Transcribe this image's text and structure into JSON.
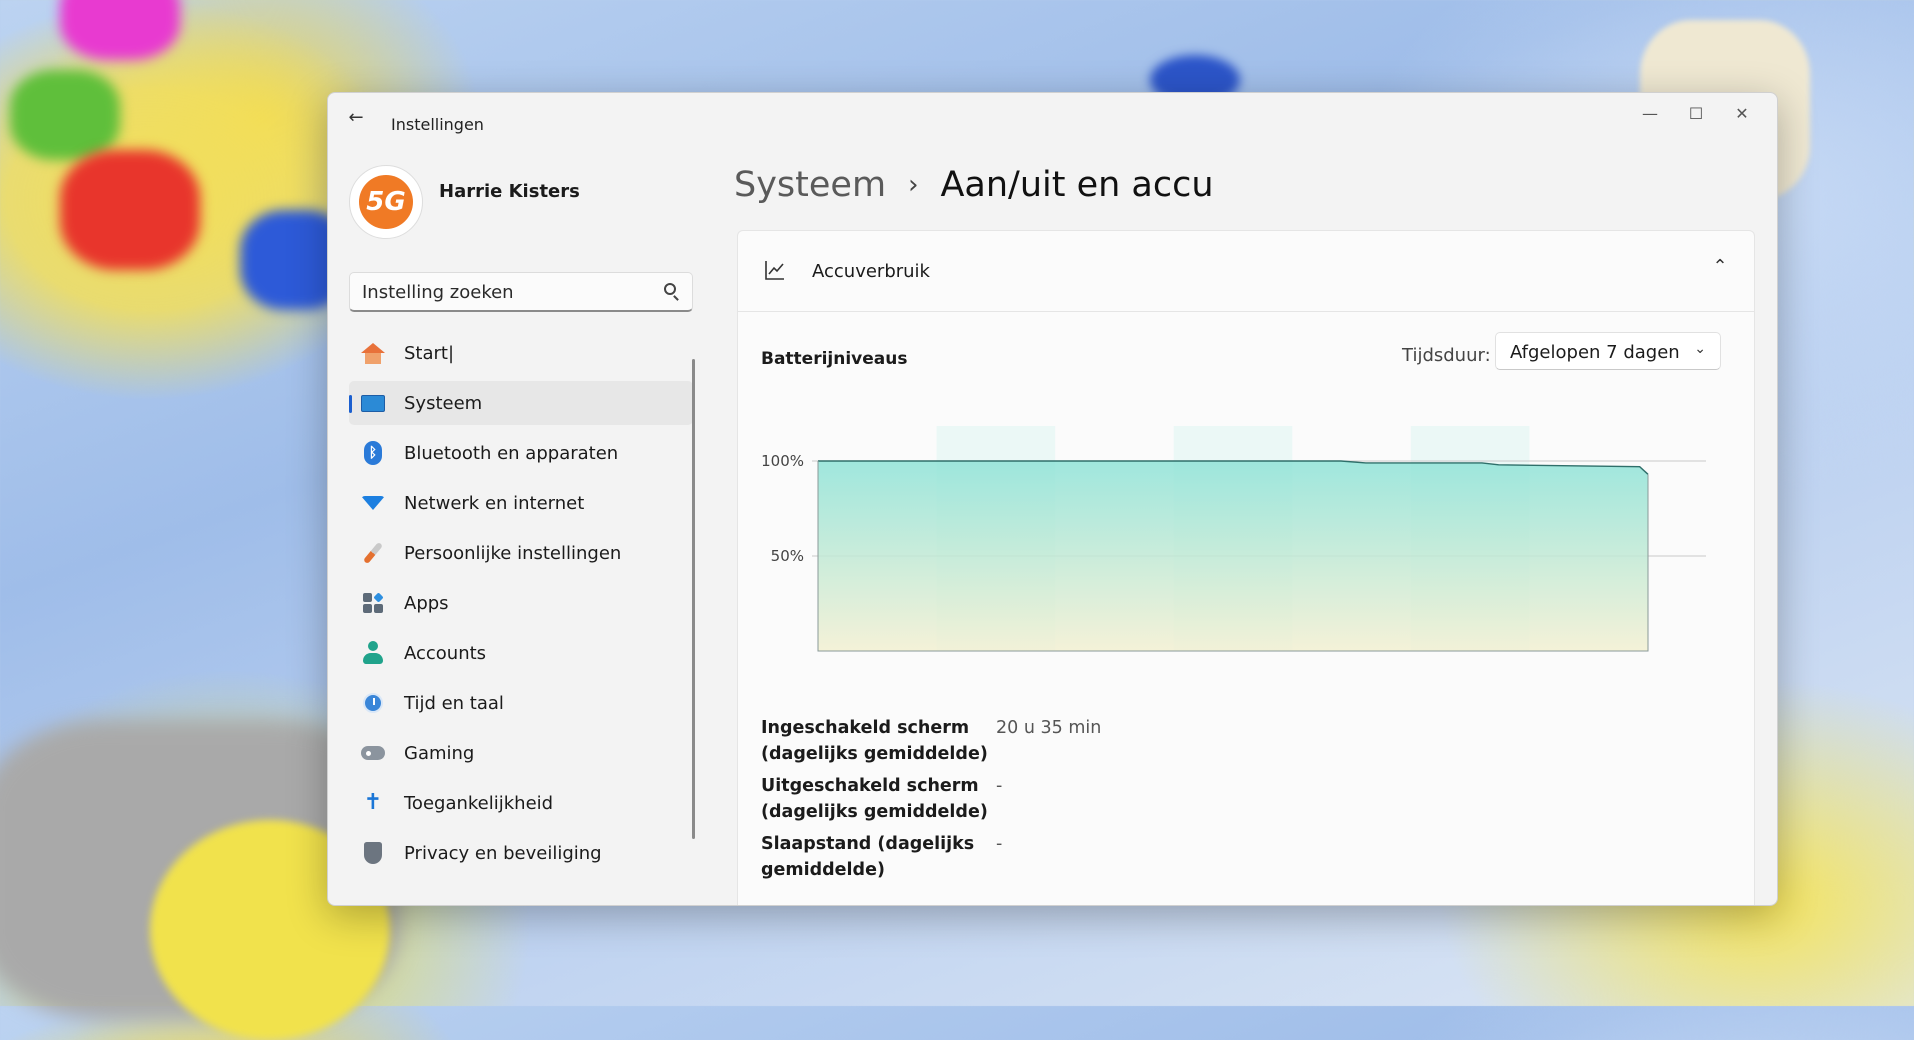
{
  "window": {
    "title": "Instellingen",
    "controls": {
      "minimize": "—",
      "maximize": "☐",
      "close": "✕"
    }
  },
  "profile": {
    "name": "Harrie Kisters",
    "avatar_text": "5G"
  },
  "search": {
    "placeholder": "Instelling zoeken"
  },
  "nav": {
    "items": [
      {
        "label": "Start|",
        "icon": "home-icon",
        "active": false
      },
      {
        "label": "Systeem",
        "icon": "monitor-icon",
        "active": true
      },
      {
        "label": "Bluetooth en apparaten",
        "icon": "bluetooth-icon",
        "active": false
      },
      {
        "label": "Netwerk en internet",
        "icon": "wifi-icon",
        "active": false
      },
      {
        "label": "Persoonlijke instellingen",
        "icon": "brush-icon",
        "active": false
      },
      {
        "label": "Apps",
        "icon": "apps-icon",
        "active": false
      },
      {
        "label": "Accounts",
        "icon": "person-icon",
        "active": false
      },
      {
        "label": "Tijd en taal",
        "icon": "clock-globe-icon",
        "active": false
      },
      {
        "label": "Gaming",
        "icon": "gamepad-icon",
        "active": false
      },
      {
        "label": "Toegankelijkheid",
        "icon": "accessibility-icon",
        "active": false
      },
      {
        "label": "Privacy en beveiliging",
        "icon": "shield-icon",
        "active": false
      }
    ]
  },
  "breadcrumb": {
    "parent": "Systeem",
    "separator": "›",
    "current": "Aan/uit en accu"
  },
  "battery": {
    "card_title": "Accuverbruik",
    "section_title": "Batterijniveaus",
    "period_label": "Tijdsduur:",
    "period_value": "Afgelopen 7 dagen",
    "stats": [
      {
        "label": "Ingeschakeld scherm (dagelijks gemiddelde)",
        "value": "20 u 35 min"
      },
      {
        "label": "Uitgeschakeld scherm (dagelijks gemiddelde)",
        "value": "-"
      },
      {
        "label": "Slaapstand (dagelijks gemiddelde)",
        "value": "-"
      }
    ]
  },
  "chart_data": {
    "type": "area",
    "y_ticks": [
      "100%",
      "50%"
    ],
    "ylim": [
      0,
      100
    ],
    "grid": true,
    "x": [
      0,
      0.63,
      0.66,
      0.8,
      0.82,
      0.99,
      1.0
    ],
    "values": [
      100,
      100,
      99,
      99,
      98,
      97,
      93
    ],
    "colors": {
      "fill_top": "#8fe3d8",
      "fill_bottom": "#f3f0d2",
      "line": "#2f6f6a",
      "day_band": "#dff6f2"
    }
  }
}
